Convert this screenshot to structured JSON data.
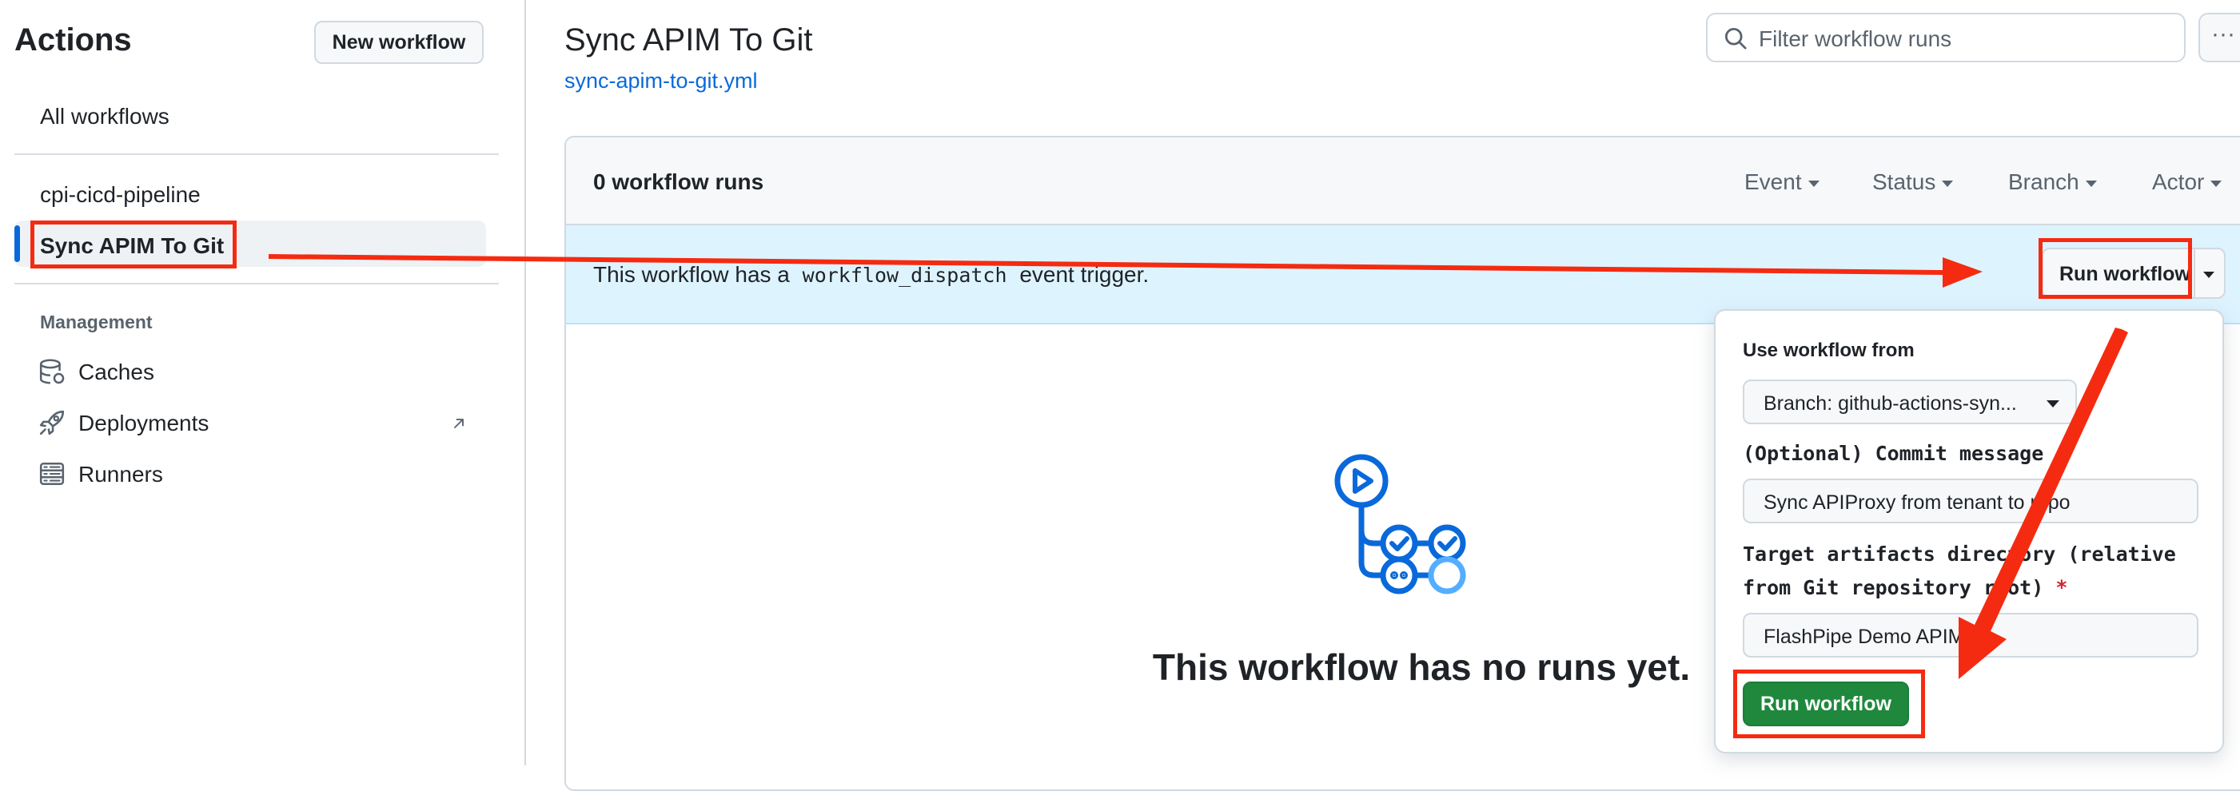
{
  "sidebar": {
    "title": "Actions",
    "new_workflow_label": "New workflow",
    "all_workflows_label": "All workflows",
    "workflows": [
      {
        "label": "cpi-cicd-pipeline"
      },
      {
        "label": "Sync APIM To Git"
      }
    ],
    "management_heading": "Management",
    "management_items": [
      {
        "label": "Caches",
        "icon": "database-icon"
      },
      {
        "label": "Deployments",
        "icon": "rocket-icon",
        "external_icon": "arrow-up-right-icon"
      },
      {
        "label": "Runners",
        "icon": "server-icon"
      }
    ]
  },
  "header": {
    "title": "Sync APIM To Git",
    "file_link": "sync-apim-to-git.yml",
    "filter_placeholder": "Filter workflow runs",
    "more_label": "···"
  },
  "runs_panel": {
    "count_label": "0 workflow runs",
    "filters": [
      "Event",
      "Status",
      "Branch",
      "Actor"
    ],
    "dispatch_prefix": "This workflow has a",
    "dispatch_code": "workflow_dispatch",
    "dispatch_suffix": "event trigger.",
    "run_workflow_dropdown_label": "Run workflow",
    "empty_title": "This workflow has no runs yet."
  },
  "popover": {
    "use_from_label": "Use workflow from",
    "branch_value": "Branch: github-actions-syn...",
    "commit_label": "(Optional) Commit message",
    "commit_value": "Sync APIProxy from tenant to repo",
    "target_label_line1": "Target artifacts directory (relative",
    "target_label_line2": "from Git repository root)",
    "required_mark": "*",
    "target_value": "FlashPipe Demo APIM",
    "run_button_label": "Run workflow"
  },
  "colors": {
    "accent": "#0969da",
    "run_green": "#1f883d",
    "annotation_red": "#f52b11",
    "dispatch_bg": "#ddf4ff"
  }
}
